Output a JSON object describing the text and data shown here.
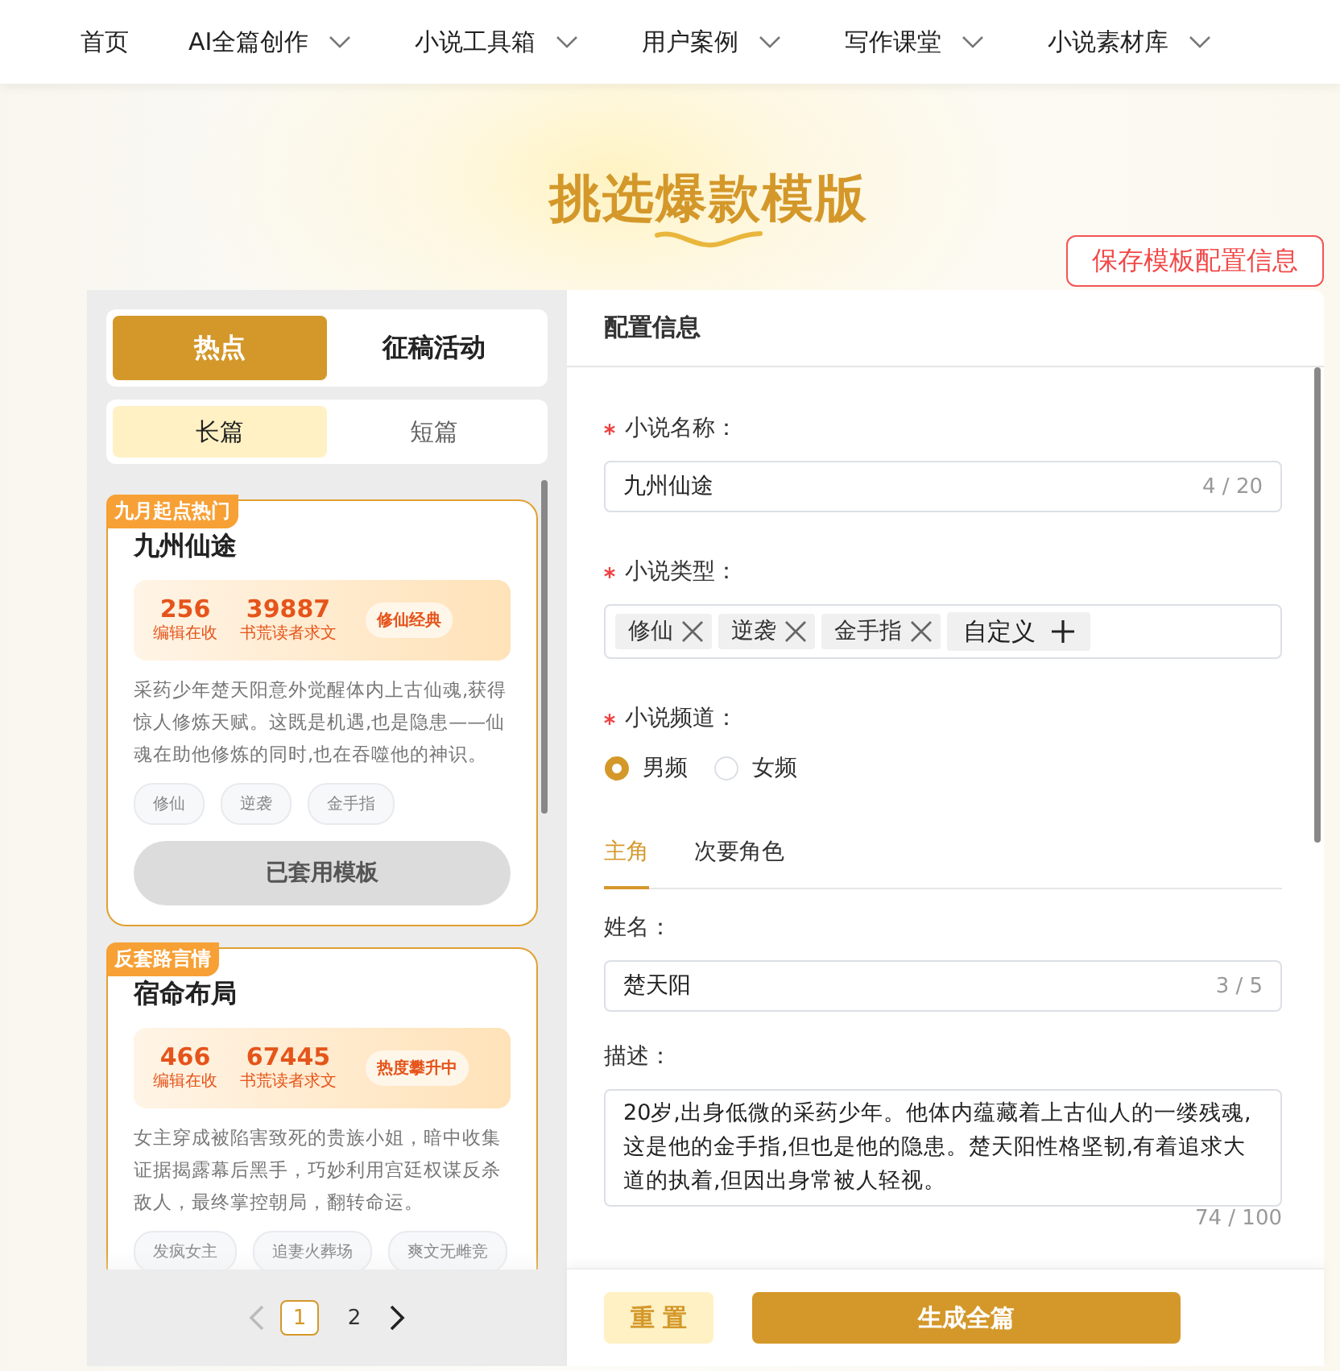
{
  "nav": {
    "items": [
      {
        "label": "首页",
        "has_menu": false
      },
      {
        "label": "AI全篇创作",
        "has_menu": true
      },
      {
        "label": "小说工具箱",
        "has_menu": true
      },
      {
        "label": "用户案例",
        "has_menu": true
      },
      {
        "label": "写作课堂",
        "has_menu": true
      },
      {
        "label": "小说素材库",
        "has_menu": true
      }
    ]
  },
  "hero": {
    "title": "挑选爆款模版",
    "save_button": "保存模板配置信息"
  },
  "left_panel": {
    "tabs": [
      {
        "label": "热点",
        "selected": true
      },
      {
        "label": "征稿活动",
        "selected": false
      }
    ],
    "sub_tabs": [
      {
        "label": "长篇",
        "selected": true
      },
      {
        "label": "短篇",
        "selected": false
      }
    ],
    "cards": [
      {
        "badge": "九月起点热门",
        "title": "九州仙途",
        "stats": [
          {
            "value": "256",
            "label": "编辑在收"
          },
          {
            "value": "39887",
            "label": "书荒读者求文"
          }
        ],
        "pill": "修仙经典",
        "description": "采药少年楚天阳意外觉醒体内上古仙魂,获得惊人修炼天赋。这既是机遇,也是隐患——仙魂在助他修炼的同时,也在吞噬他的神识。",
        "tags": [
          "修仙",
          "逆袭",
          "金手指"
        ],
        "button": {
          "label": "已套用模板",
          "disabled": true
        }
      },
      {
        "badge": "反套路言情",
        "title": "宿命布局",
        "stats": [
          {
            "value": "466",
            "label": "编辑在收"
          },
          {
            "value": "67445",
            "label": "书荒读者求文"
          }
        ],
        "pill": "热度攀升中",
        "description": "女主穿成被陷害致死的贵族小姐，暗中收集证据揭露幕后黑手，巧妙利用宫廷权谋反杀敌人，最终掌控朝局，翻转命运。",
        "tags": [
          "发疯女主",
          "追妻火葬场",
          "爽文无雌竞"
        ]
      }
    ],
    "pagination": {
      "prev_disabled": true,
      "next_disabled": false,
      "pages": [
        {
          "label": "1",
          "selected": true
        },
        {
          "label": "2",
          "selected": false
        }
      ]
    }
  },
  "config_panel": {
    "title": "配置信息",
    "name_field": {
      "label": "小说名称：",
      "required": true,
      "value": "九州仙途",
      "count": "4 / 20"
    },
    "genre_field": {
      "label": "小说类型：",
      "required": true,
      "tags": [
        "修仙",
        "逆袭",
        "金手指"
      ],
      "custom_button": "自定义"
    },
    "channel_field": {
      "label": "小说频道：",
      "required": true,
      "options": [
        {
          "label": "男频",
          "selected": true
        },
        {
          "label": "女频",
          "selected": false
        }
      ]
    },
    "character_tabs": [
      {
        "label": "主角",
        "selected": true
      },
      {
        "label": "次要角色",
        "selected": false
      }
    ],
    "character_name": {
      "label": "姓名：",
      "value": "楚天阳",
      "count": "3 / 5"
    },
    "character_description": {
      "label": "描述：",
      "value": "20岁,出身低微的采药少年。他体内蕴藏着上古仙人的一缕残魂,这是他的金手指,但也是他的隐患。楚天阳性格坚韧,有着追求大道的执着,但因出身常被人轻视。",
      "count": "74 / 100"
    },
    "reset_button": "重 置",
    "generate_button": "生成全篇"
  }
}
